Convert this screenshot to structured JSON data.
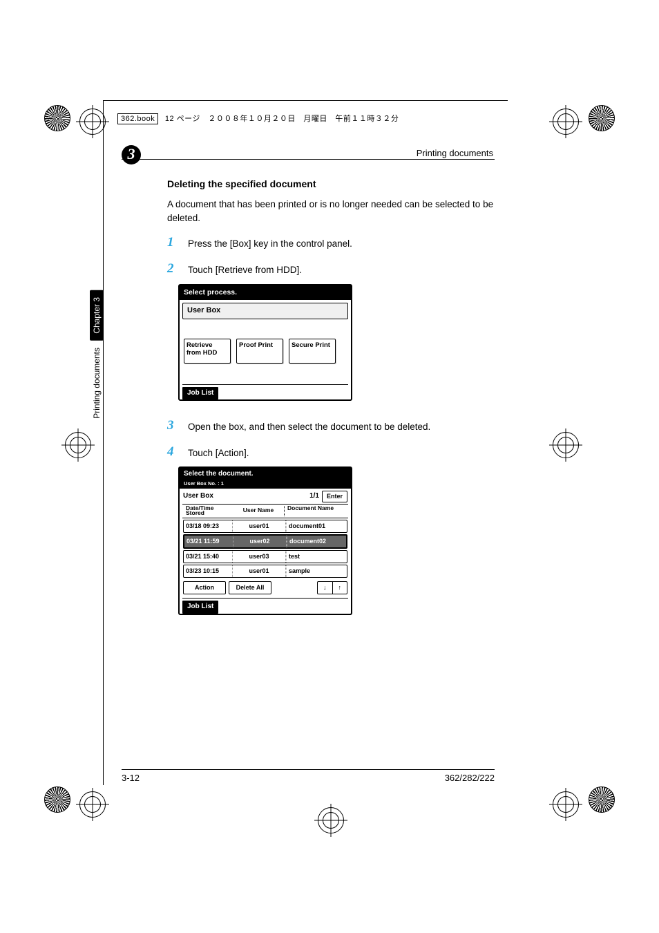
{
  "meta": {
    "book_label": "362.book",
    "jp_text": "12 ページ　２００８年１０月２０日　月曜日　午前１１時３２分"
  },
  "chapter_badge": "3",
  "header_right": "Printing documents",
  "side": {
    "chapter": "Chapter 3",
    "label": "Printing documents"
  },
  "section_title": "Deleting the specified document",
  "intro": "A document that has been printed or is no longer needed can be selected to be deleted.",
  "steps": {
    "s1_num": "1",
    "s1_txt": "Press the [Box] key in the control panel.",
    "s2_num": "2",
    "s2_txt": "Touch [Retrieve from HDD].",
    "s3_num": "3",
    "s3_txt": "Open the box, and then select the document to be deleted.",
    "s4_num": "4",
    "s4_txt": "Touch [Action]."
  },
  "panel1": {
    "title": "Select process.",
    "sub": "User Box",
    "b1": "Retrieve from HDD",
    "b2": "Proof Print",
    "b3": "Secure Print",
    "joblist": "Job List"
  },
  "panel2": {
    "title": "Select the document.",
    "subline_label": "User Box No.",
    "subline_sep": " : ",
    "subline_value": "1",
    "boxlabel": "User Box",
    "page": "1/1",
    "enter": "Enter",
    "col1": "Date/Time Stored",
    "col2": "User Name",
    "col3": "Document Name",
    "rows": [
      {
        "d": "03/18 09:23",
        "u": "user01",
        "n": "document01"
      },
      {
        "d": "03/21 11:59",
        "u": "user02",
        "n": "document02"
      },
      {
        "d": "03/21 15:40",
        "u": "user03",
        "n": "test"
      },
      {
        "d": "03/23 10:15",
        "u": "user01",
        "n": "sample"
      }
    ],
    "action": "Action",
    "deleteall": "Delete All",
    "down": "↓",
    "up": "↑",
    "joblist": "Job List"
  },
  "footer": {
    "left": "3-12",
    "right": "362/282/222"
  }
}
